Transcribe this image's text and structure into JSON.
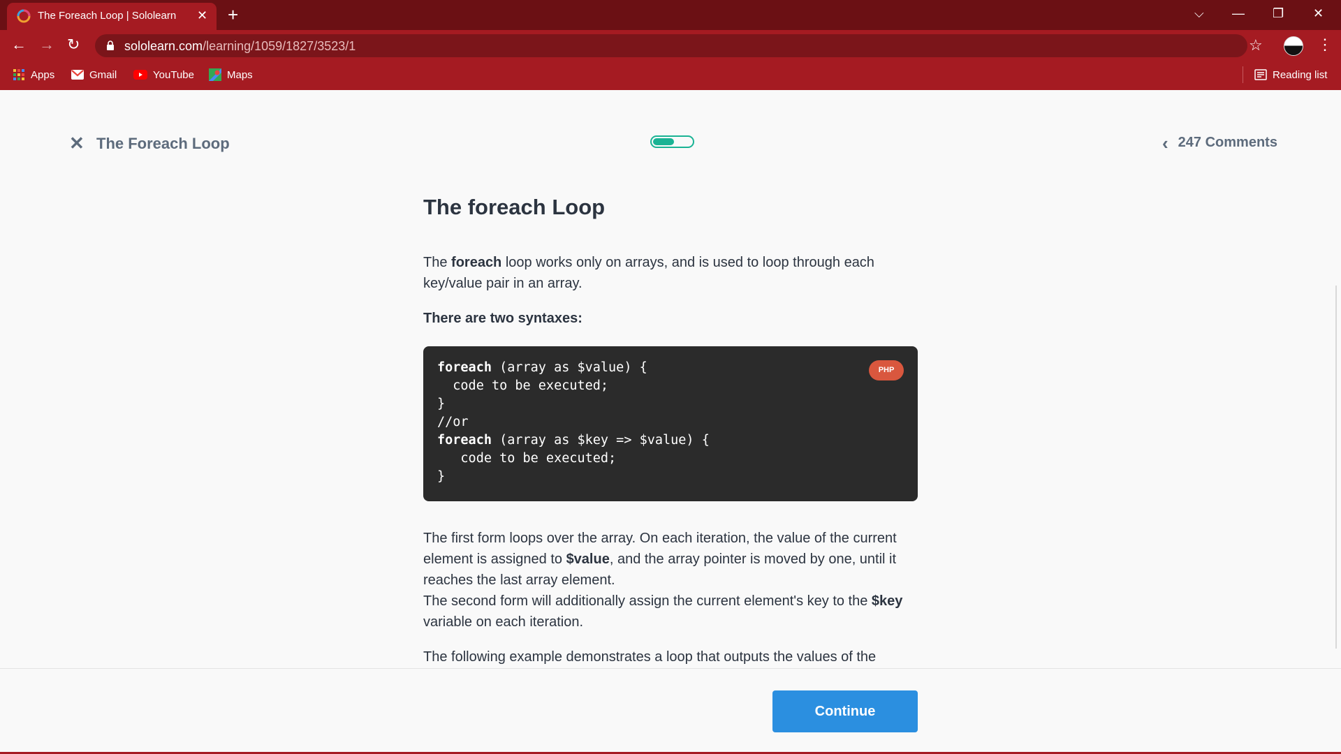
{
  "browser": {
    "tab": {
      "title": "The Foreach Loop | Sololearn",
      "close_glyph": "✕"
    },
    "new_tab_glyph": "+",
    "window_controls": {
      "dropdown": "⌵",
      "minimize": "—",
      "restore": "❐",
      "close": "✕"
    },
    "nav": {
      "back": "←",
      "forward": "→",
      "reload": "↻"
    },
    "url": {
      "host": "sololearn.com",
      "path": "/learning/1059/1827/3523/1"
    },
    "star_glyph": "☆",
    "menu_glyph": "⋮",
    "bookmarks": [
      {
        "label": "Apps",
        "icon": "apps-grid-icon"
      },
      {
        "label": "Gmail",
        "icon": "gmail-icon"
      },
      {
        "label": "YouTube",
        "icon": "youtube-icon"
      },
      {
        "label": "Maps",
        "icon": "maps-icon"
      }
    ],
    "reading_list": "Reading list"
  },
  "lesson": {
    "close_glyph": "✕",
    "title": "The Foreach Loop",
    "progress_fraction": 0.55,
    "comments_chevron": "‹",
    "comments": "247 Comments"
  },
  "content": {
    "heading": "The foreach Loop",
    "intro": {
      "before": "The ",
      "bold": "foreach",
      "after": " loop works only on arrays, and is used to loop through each key/value pair in an array."
    },
    "syntaxes_label": "There are two syntaxes:",
    "code": {
      "language": "PHP",
      "lines": [
        {
          "kw": "foreach",
          "rest": " (array as $value) {"
        },
        {
          "kw": "",
          "rest": "  code to be executed;"
        },
        {
          "kw": "",
          "rest": "}"
        },
        {
          "kw": "",
          "rest": "//or"
        },
        {
          "kw": "foreach",
          "rest": " (array as $key => $value) {"
        },
        {
          "kw": "",
          "rest": "   code to be executed;"
        },
        {
          "kw": "",
          "rest": "}"
        }
      ]
    },
    "para2": {
      "a": "The first form loops over the array. On each iteration, the value of the current element is assigned to ",
      "b": "$value",
      "c": ", and the array pointer is moved by one, until it reaches the last array element."
    },
    "para3": {
      "a": "The second form will additionally assign the current element's key to the ",
      "b": "$key",
      "c": " variable on each iteration."
    },
    "para4": "The following example demonstrates a loop that outputs the values of the"
  },
  "footer": {
    "continue": "Continue"
  },
  "colors": {
    "chrome_dark": "#6b1014",
    "chrome": "#a51b22",
    "accent_green": "#1ab394",
    "button_blue": "#2b8fe0",
    "badge": "#d9573e"
  }
}
